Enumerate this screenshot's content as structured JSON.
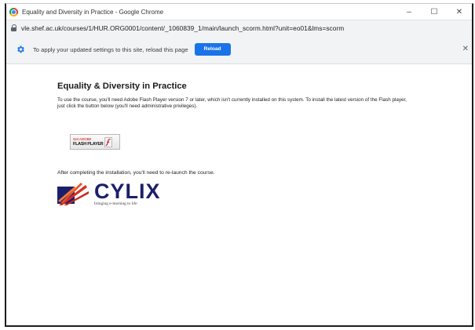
{
  "window": {
    "title": "Equality and Diversity in Practice - Google Chrome",
    "controls": {
      "minimize": "–",
      "maximize": "☐",
      "close": "✕"
    }
  },
  "address_bar": {
    "url": "vle.shef.ac.uk/courses/1/HUR.ORG0001/content/_1060839_1/main/launch_scorm.html?unit=eo01&lms=scorm"
  },
  "infobar": {
    "message": "To apply your updated settings to this site, reload this page",
    "reload_label": "Reload",
    "close_glyph": "✕"
  },
  "page": {
    "title": "Equality & Diversity in Practice",
    "description": "To use the course, you'll need Adobe Flash Player version 7 or later, which isn't currently installed on this system. To install the latest version of the Flash player, just click the button below (you'll need administrative privileges).",
    "flash_badge": {
      "get": "Get ADOBE",
      "name": "FLASH PLAYER"
    },
    "after_install": "After completing the installation, you'll need to re-launch the course.",
    "logo": {
      "word": "CYLIX",
      "tagline": "bringing e-learning to life"
    }
  },
  "colors": {
    "reload_button": "#1a73e8",
    "cylix_navy": "#1b1f6b",
    "cylix_red": "#d9301f",
    "infobar_bg": "#f1f3f4"
  }
}
